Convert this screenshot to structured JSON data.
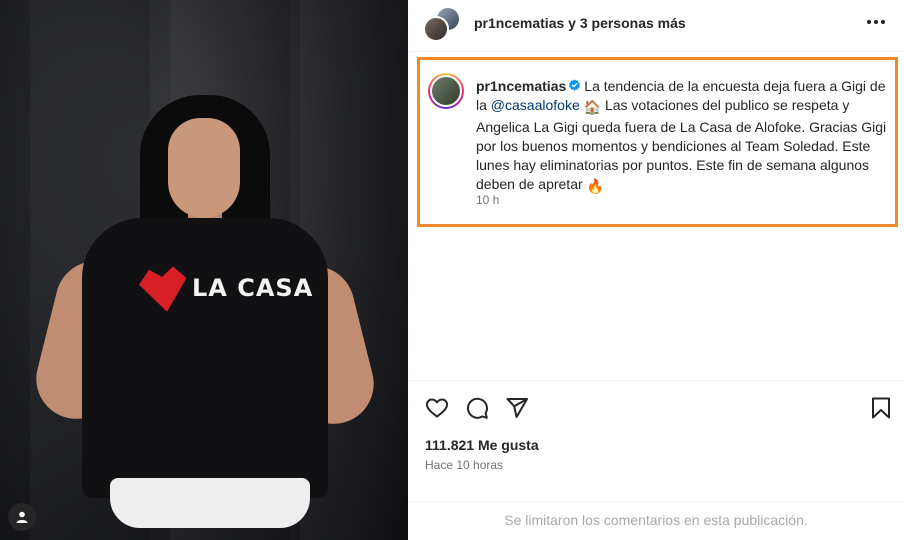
{
  "post": {
    "header": {
      "username": "pr1ncematias",
      "coauthors": "y 3 personas más",
      "more_options_icon": "more-horizontal-icon"
    },
    "photo": {
      "shirt_logo_text": "LA CASA"
    },
    "caption": {
      "username": "pr1ncematias",
      "text_1": "La tendencia de la encuesta deja fuera a Gigi de la ",
      "mention": "@casaalofoke",
      "emoji_house": "🏠",
      "text_2": " Las votaciones del publico se respeta y Angelica La Gigi queda fuera de La Casa de Alofoke. Gracias Gigi por los buenos momentos y bendiciones al Team Soledad. Este lunes hay eliminatorias por puntos. Este fin de semana algunos deben de apretar ",
      "emoji_fire": "🔥",
      "time": "10 h"
    },
    "actions": {
      "like_icon": "heart-icon",
      "comment_icon": "comment-icon",
      "share_icon": "send-icon",
      "save_icon": "bookmark-icon"
    },
    "likes_text": "111.821 Me gusta",
    "posted_ago": "Hace 10 horas",
    "comments_notice": "Se limitaron los comentarios en esta publicación."
  },
  "colors": {
    "highlight_border": "#f0882c",
    "mention": "#00376b",
    "verified": "#0095f6",
    "secondary_text": "#737373"
  }
}
